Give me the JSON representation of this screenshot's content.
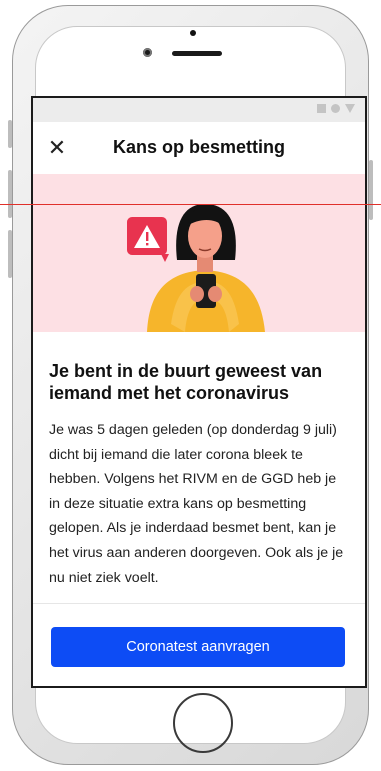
{
  "statusbar": {
    "icons": [
      "square-icon",
      "circle-icon",
      "triangle-icon"
    ]
  },
  "header": {
    "close_icon": "close-icon",
    "close_glyph": "✕",
    "title": "Kans op besmetting"
  },
  "illustration": {
    "alert_glyph": "!",
    "background": "#fde0e4",
    "accent": "#e8334f"
  },
  "main": {
    "heading": "Je bent in de buurt geweest van iemand met het coronavirus",
    "body": "Je was 5 dagen geleden (op donderdag 9 juli) dicht bij iemand die later corona bleek te hebben. Volgens het RIVM en de GGD heb je in deze situatie extra kans op besmetting gelopen. Als je inderdaad besmet bent, kan je het virus aan anderen doorgeven. Ook als je je nu niet ziek voelt."
  },
  "footer": {
    "cta_label": "Coronatest aanvragen",
    "cta_color": "#0d4cf5"
  }
}
